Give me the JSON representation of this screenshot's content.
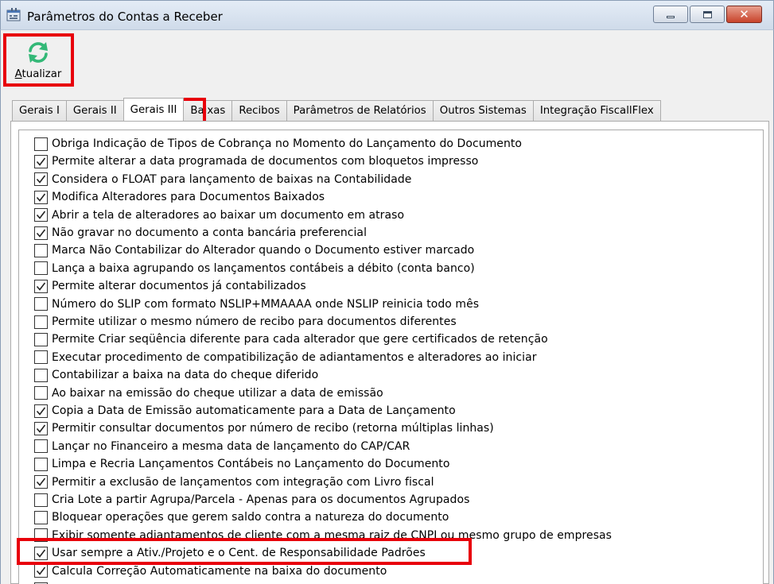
{
  "window": {
    "title": "Parâmetros do Contas a Receber",
    "icon": "app-window-icon",
    "controls": [
      "minimize",
      "maximize",
      "close"
    ],
    "close_symbol": "✕"
  },
  "toolbar": {
    "refresh_label_first": "A",
    "refresh_label_rest": "tualizar",
    "refresh_icon": "refresh-icon",
    "refresh_icon_color": "#33b877"
  },
  "tabs": [
    {
      "label": "Gerais I",
      "active": false
    },
    {
      "label": "Gerais II",
      "active": false
    },
    {
      "label": "Gerais III",
      "active": true
    },
    {
      "label": "Baixas",
      "active": false
    },
    {
      "label": "Recibos",
      "active": false
    },
    {
      "label": "Parâmetros de Relatórios",
      "active": false
    },
    {
      "label": "Outros Sistemas",
      "active": false
    },
    {
      "label": "Integração FiscallFlex",
      "active": false
    }
  ],
  "options": [
    {
      "label": "Obriga Indicação de Tipos de Cobrança no Momento do Lançamento do Documento",
      "checked": false
    },
    {
      "label": "Permite alterar a data programada de documentos com bloquetos impresso",
      "checked": true
    },
    {
      "label": "Considera o FLOAT para lançamento de baixas na Contabilidade",
      "checked": true
    },
    {
      "label": "Modifica Alteradores para Documentos Baixados",
      "checked": true
    },
    {
      "label": "Abrir a tela de alteradores ao baixar um documento em atraso",
      "checked": true
    },
    {
      "label": "Não gravar no documento a conta bancária preferencial",
      "checked": true
    },
    {
      "label": "Marca Não Contabilizar do Alterador quando o Documento estiver marcado",
      "checked": false
    },
    {
      "label": "Lança a baixa agrupando os lançamentos contábeis a débito (conta banco)",
      "checked": false
    },
    {
      "label": "Permite alterar documentos já contabilizados",
      "checked": true
    },
    {
      "label": "Número do SLIP com formato NSLIP+MMAAAA onde NSLIP reinicia todo mês",
      "checked": false
    },
    {
      "label": "Permite utilizar o mesmo número de recibo para documentos diferentes",
      "checked": false
    },
    {
      "label": "Permite Criar seqüência diferente para cada alterador que gere certificados de retenção",
      "checked": false
    },
    {
      "label": "Executar procedimento de compatibilização de adiantamentos e alteradores ao iniciar",
      "checked": false
    },
    {
      "label": "Contabilizar a baixa na data do cheque diferido",
      "checked": false
    },
    {
      "label": "Ao baixar na emissão do cheque utilizar a data de emissão",
      "checked": false
    },
    {
      "label": "Copia a Data de Emissão automaticamente para a Data de Lançamento",
      "checked": true
    },
    {
      "label": "Permitir consultar documentos por número de recibo (retorna múltiplas linhas)",
      "checked": true
    },
    {
      "label": "Lançar no Financeiro a mesma data de lançamento do CAP/CAR",
      "checked": false
    },
    {
      "label": "Limpa e Recria Lançamentos Contábeis no Lançamento do Documento",
      "checked": false
    },
    {
      "label": "Permitir a exclusão de lançamentos com integração com Livro fiscal",
      "checked": true
    },
    {
      "label": "Cria Lote a partir Agrupa/Parcela - Apenas para os documentos Agrupados",
      "checked": false
    },
    {
      "label": "Bloquear operações que gerem saldo contra a natureza do documento",
      "checked": false
    },
    {
      "label": "Exibir somente adiantamentos de cliente com a mesma raiz de CNPJ ou mesmo grupo de empresas",
      "checked": false
    },
    {
      "label": "Usar sempre a Ativ./Projeto e o Cent. de Responsabilidade Padrões",
      "checked": true
    },
    {
      "label": "Calcula Correção Automaticamente na baixa do documento",
      "checked": true
    },
    {
      "label": "",
      "checked": false
    }
  ],
  "highlight_color": "#e8000b"
}
